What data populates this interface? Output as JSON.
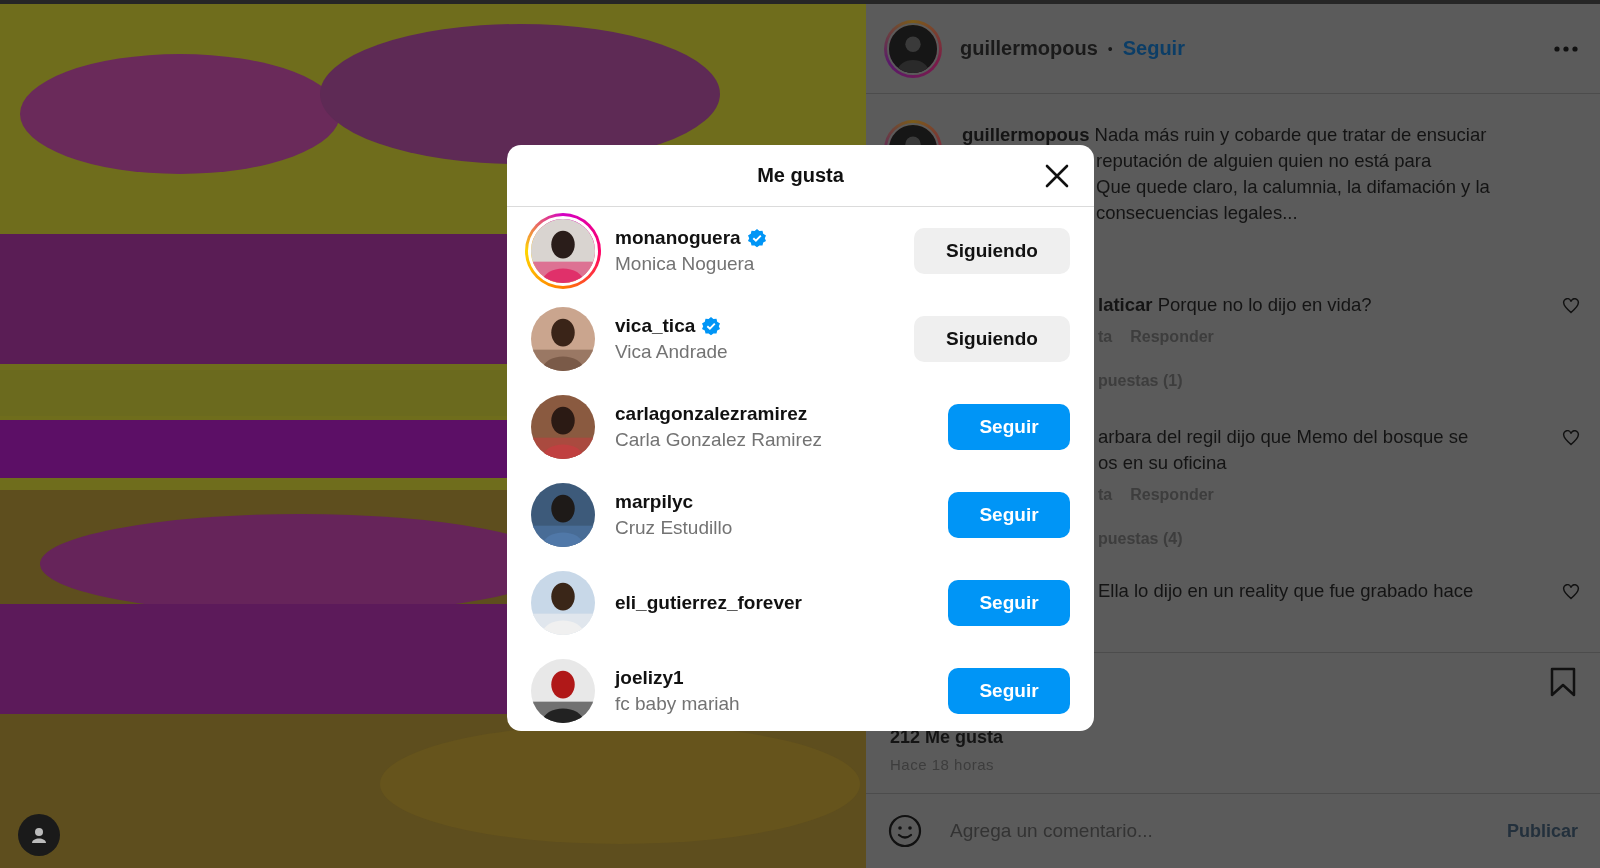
{
  "post_header": {
    "username": "guillermopous",
    "separator": "•",
    "follow": "Seguir",
    "story_ring": true
  },
  "caption": {
    "story_ring": true,
    "lines": [
      "**guillermopous** Nada más ruin y cobarde que tratar de ensuciar",
      "reputación de alguien quien no está para",
      "Que quede claro, la calumnia, la difamación y la",
      "consecuencias legales..."
    ]
  },
  "comments": [
    {
      "lines": [
        "**laticar** Porque no lo dijo en vida?"
      ],
      "action_fragment": "ta",
      "reply": "Responder",
      "replies": "puestas (1)"
    },
    {
      "lines": [
        "arbara del regil dijo que Memo del bosque se",
        "os en su oficina"
      ],
      "action_fragment": "ta",
      "reply": "Responder",
      "replies": "puestas (4)"
    },
    {
      "lines": [
        "Ella lo dijo en un reality que fue grabado hace"
      ]
    }
  ],
  "likes": "212 Me gusta",
  "time": "Hace 18 horas",
  "comment_field": {
    "placeholder": "Agrega un comentario...",
    "publish": "Publicar",
    "disabled": true
  },
  "modal": {
    "title": "Me gusta",
    "users": [
      {
        "username": "monanoguera",
        "verified": true,
        "full_name": "Monica Noguera",
        "following": true,
        "button": "Siguiendo",
        "story_ring": true
      },
      {
        "username": "vica_tica",
        "verified": true,
        "full_name": "Vica Andrade",
        "following": true,
        "button": "Siguiendo",
        "story_ring": false
      },
      {
        "username": "carlagonzalezramirez",
        "verified": false,
        "full_name": "Carla Gonzalez Ramirez",
        "following": false,
        "button": "Seguir",
        "story_ring": false
      },
      {
        "username": "marpilyc",
        "verified": false,
        "full_name": "Cruz Estudillo",
        "following": false,
        "button": "Seguir",
        "story_ring": false
      },
      {
        "username": "eli_gutierrez_forever",
        "verified": false,
        "following": false,
        "button": "Seguir",
        "story_ring": false
      },
      {
        "username": "joelizy1",
        "verified": false,
        "full_name": "fc baby mariah",
        "following": false,
        "button": "Seguir",
        "story_ring": false
      }
    ]
  }
}
